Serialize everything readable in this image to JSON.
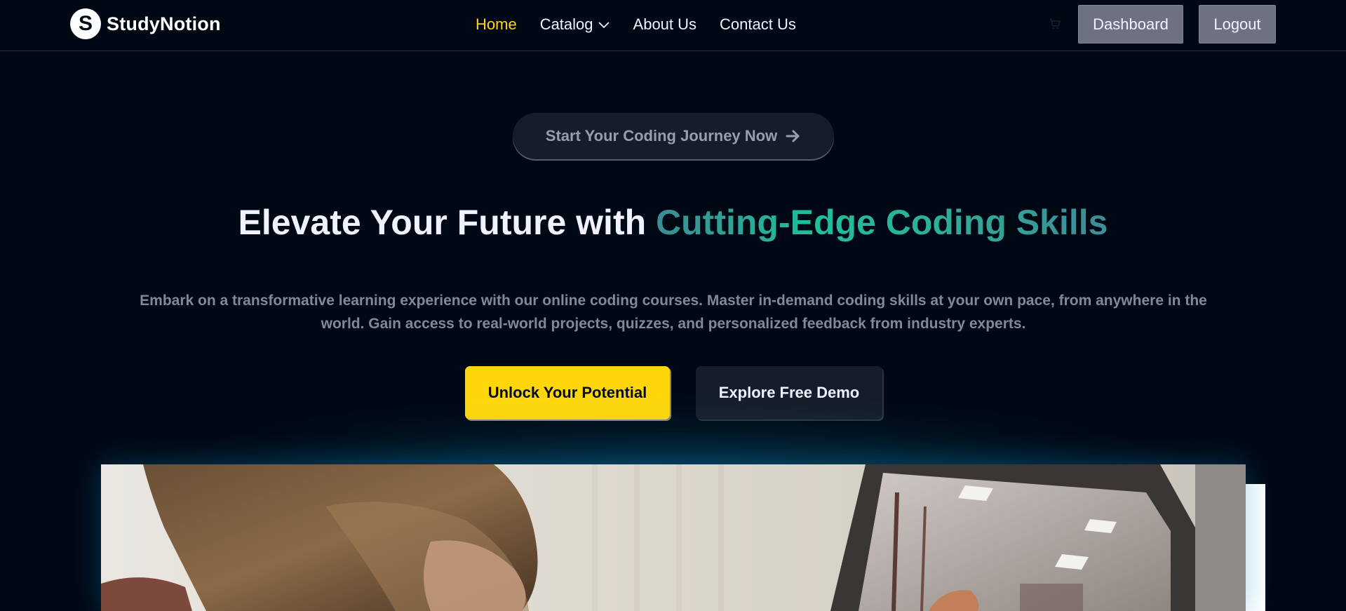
{
  "brand": {
    "logo_letter": "S",
    "name": "StudyNotion"
  },
  "nav": {
    "items": [
      {
        "label": "Home",
        "active": true
      },
      {
        "label": "Catalog",
        "has_dropdown": true
      },
      {
        "label": "About Us"
      },
      {
        "label": "Contact Us"
      }
    ],
    "dashboard_label": "Dashboard",
    "logout_label": "Logout"
  },
  "hero": {
    "pill_label": "Start Your Coding Journey Now",
    "headline_plain": "Elevate Your Future with ",
    "headline_highlight": "Cutting-Edge Coding Skills",
    "subtext_line1": "Embark on a transformative learning experience with our online coding courses. Master in-demand coding skills at your own pace, from anywhere in the",
    "subtext_line2": "world. Gain access to real-world projects, quizzes, and personalized feedback from industry experts.",
    "primary_cta": "Unlock Your Potential",
    "secondary_cta": "Explore Free Demo"
  },
  "colors": {
    "background": "#000814",
    "accent_yellow": "#FFD60A",
    "nav_button_bg": "#6E727F",
    "secondary_button_bg": "#161D29",
    "highlight_teal": "#1FBF9B"
  },
  "icons": {
    "cart": "cart-icon",
    "catalog_dropdown": "chevron-down-icon",
    "pill_arrow": "arrow-right-icon"
  }
}
